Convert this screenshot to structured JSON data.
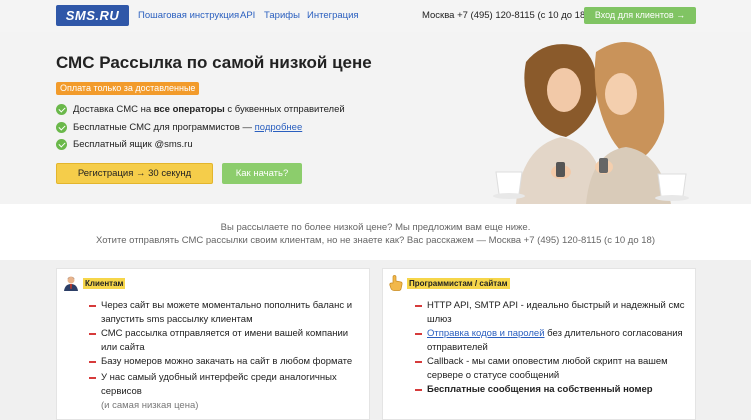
{
  "header": {
    "logo_text": "SMS.RU",
    "nav": [
      "Пошаговая инструкция",
      "API",
      "Тарифы",
      "Интеграция"
    ],
    "contact": "Москва  +7 (495) 120-8115 (с 10 до 18)",
    "clients_button": "Вход для клиентов →"
  },
  "hero": {
    "title": "СМС Рассылка по самой низкой цене",
    "badge": "Оплата только за доставленные",
    "feature1_pre": "Доставка СМС на ",
    "feature1_bold": "все операторы",
    "feature1_post": " с буквенных отправителей",
    "feature2_pre": "Бесплатные СМС для программистов — ",
    "feature2_link": "подробнее",
    "feature3": "Бесплатный ящик @sms.ru",
    "register_button": "Регистрация → 30 секунд",
    "howto_button": "Как начать?"
  },
  "band": {
    "line1": "Вы рассылаете по более низкой цене? Мы предложим вам еще ниже.",
    "line2": "Хотите отправлять СМС рассылки своим клиентам, но не знаете как? Вас расскажем — Москва  +7 (495) 120-8115 (с 10 до 18)"
  },
  "clients_card": {
    "tag": "Клиентам",
    "items": [
      "Через сайт вы можете моментально пополнить баланс и запустить sms рассылку клиентам",
      "СМС рассылка отправляется от имени вашей компании или сайта",
      "Базу номеров можно закачать на сайт в любом формате",
      "У нас самый удобный интерфейс среди аналогичных сервисов"
    ],
    "item4_note": "(и самая низкая цена)"
  },
  "dev_card": {
    "tag": "Программистам / сайтам",
    "item1": "HTTP API, SMTP API - идеально быстрый и надежный смс шлюз",
    "item2_link": "Отправка кодов и паролей",
    "item2_post": " без длительного согласования отправителей",
    "item3": "Callback - мы сами оповестим любой скрипт на вашем сервере о статусе сообщений",
    "item4": "Бесплатные сообщения на собственный номер"
  },
  "colors": {
    "brand": "#2f57a8",
    "accent_green": "#80c463",
    "badge_orange": "#f29b2b",
    "yellow": "#f5cd4a",
    "link": "#2a5fbf"
  }
}
